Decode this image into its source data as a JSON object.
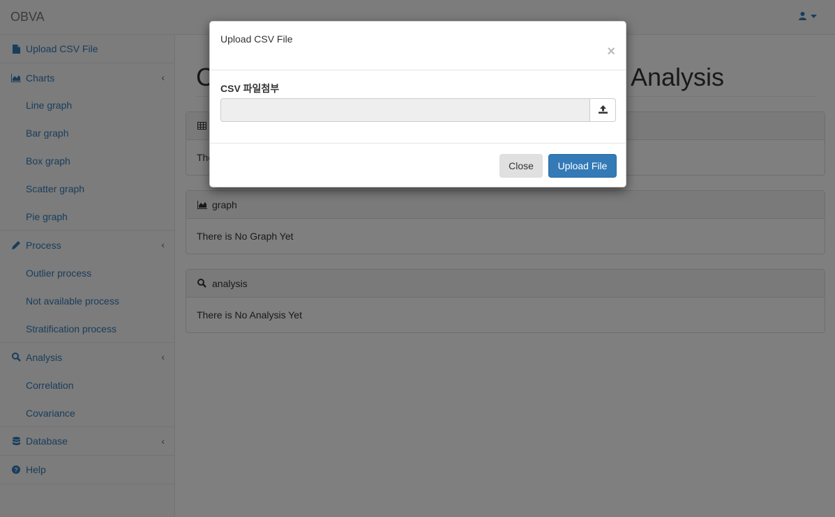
{
  "navbar": {
    "brand": "OBVA",
    "user_icon": "user-icon",
    "caret_icon": "caret-down-icon"
  },
  "sidebar": {
    "upload": {
      "label": "Upload CSV File",
      "icon": "file-icon"
    },
    "charts": {
      "label": "Charts",
      "icon": "area-chart-icon",
      "items": [
        "Line graph",
        "Bar graph",
        "Box graph",
        "Scatter graph",
        "Pie graph"
      ]
    },
    "process": {
      "label": "Process",
      "icon": "pencil-icon",
      "items": [
        "Outlier process",
        "Not available process",
        "Stratification process"
      ]
    },
    "analysis": {
      "label": "Analysis",
      "icon": "search-icon",
      "items": [
        "Correlation",
        "Covariance"
      ]
    },
    "database": {
      "label": "Database",
      "icon": "database-icon"
    },
    "help": {
      "label": "Help",
      "icon": "question-circle-icon"
    },
    "chevron": "‹"
  },
  "main": {
    "title_start": "C",
    "title_end": "Analysis",
    "panels": [
      {
        "heading": "",
        "icon": "table-icon",
        "body": "The"
      },
      {
        "heading": "graph",
        "icon": "area-chart-icon",
        "body": "There is No Graph Yet"
      },
      {
        "heading": "analysis",
        "icon": "search-icon",
        "body": "There is No Analysis Yet"
      }
    ]
  },
  "modal": {
    "title": "Upload CSV File",
    "close_symbol": "×",
    "field_label": "CSV 파일첨부",
    "upload_icon": "upload-icon",
    "close_button": "Close",
    "upload_button": "Upload File"
  },
  "colors": {
    "link": "#337ab7",
    "primary": "#337ab7",
    "backdrop": "rgba(0,0,0,0.5)"
  }
}
